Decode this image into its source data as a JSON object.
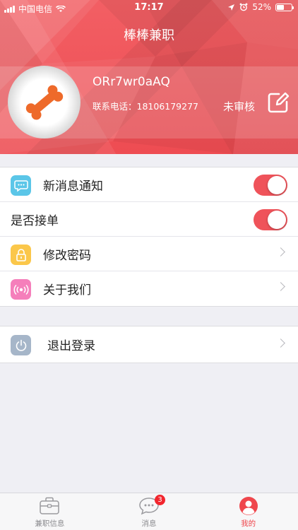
{
  "statusbar": {
    "carrier": "中国电信",
    "time": "17:17",
    "battery_text": "52%",
    "battery_level": 0.52
  },
  "header": {
    "title": "棒棒兼职"
  },
  "profile": {
    "username": "ORr7wr0aAQ",
    "phone_label": "联系电话：",
    "phone": "18106179277",
    "audit_status": "未审核"
  },
  "settings": {
    "notify_label": "新消息通知",
    "notify_on": true,
    "accept_label": "是否接单",
    "accept_on": true,
    "password_label": "修改密码",
    "about_label": "关于我们"
  },
  "logout": {
    "label": "退出登录"
  },
  "tabbar": {
    "tabs": [
      {
        "label": "兼职信息",
        "icon": "briefcase-icon"
      },
      {
        "label": "消息",
        "icon": "chat-bubble-icon"
      },
      {
        "label": "我的",
        "icon": "user-icon"
      }
    ],
    "message_badge": "3",
    "active_index": 2
  },
  "colors": {
    "accent": "#ef474d",
    "header_red": "#f05a5f"
  }
}
